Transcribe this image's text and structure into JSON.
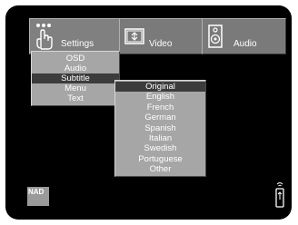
{
  "tabs": [
    {
      "label": "Settings",
      "icon": "hand-pointer-icon",
      "active": true
    },
    {
      "label": "Video",
      "icon": "display-icon",
      "active": false
    },
    {
      "label": "Audio",
      "icon": "speaker-icon",
      "active": false
    }
  ],
  "settings_menu": {
    "items": [
      "OSD",
      "Audio",
      "Subtitle",
      "Menu",
      "Text"
    ],
    "selected": "Subtitle"
  },
  "subtitle_options": {
    "items": [
      "Original",
      "English",
      "French",
      "German",
      "Spanish",
      "Italian",
      "Swedish",
      "Portuguese",
      "Other"
    ],
    "selected": "Original"
  },
  "brand": {
    "logo_text": "NAD"
  },
  "colors": {
    "background": "#000000",
    "tab": "#7a7a7a",
    "menu": "#a6a6a6",
    "highlight": "#3c3c3c",
    "text": "#ffffff"
  },
  "icons": {
    "remote": "remote-control-icon"
  }
}
